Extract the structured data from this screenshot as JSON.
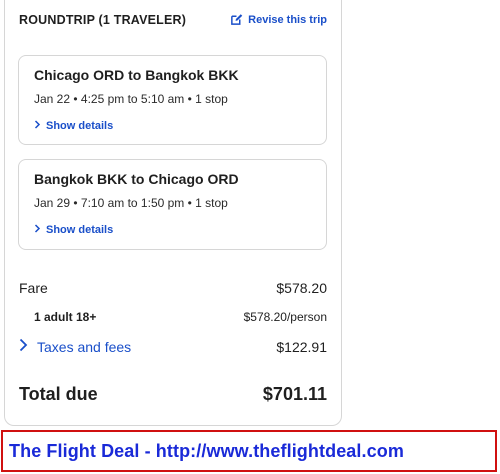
{
  "header": {
    "title": "ROUNDTRIP (1 TRAVELER)",
    "revise_label": "Revise this trip",
    "revise_icon": "edit-icon"
  },
  "flights": [
    {
      "route": "Chicago ORD to Bangkok BKK",
      "times": "Jan 22 • 4:25 pm to 5:10 am • 1 stop",
      "details_label": "Show details"
    },
    {
      "route": "Bangkok BKK to Chicago ORD",
      "times": "Jan 29 • 7:10 am to 1:50 pm • 1 stop",
      "details_label": "Show details"
    }
  ],
  "pricing": {
    "fare_label": "Fare",
    "fare_value": "$578.20",
    "adult_label": "1 adult 18+",
    "adult_value": "$578.20/person",
    "taxes_label": "Taxes and fees",
    "taxes_value": "$122.91",
    "total_label": "Total due",
    "total_value": "$701.11"
  },
  "banner": {
    "text": "The Flight Deal - http://www.theflightdeal.com"
  },
  "colors": {
    "link": "#1a4fc9",
    "banner_border": "#d01010",
    "banner_text": "#1a2ad8"
  }
}
